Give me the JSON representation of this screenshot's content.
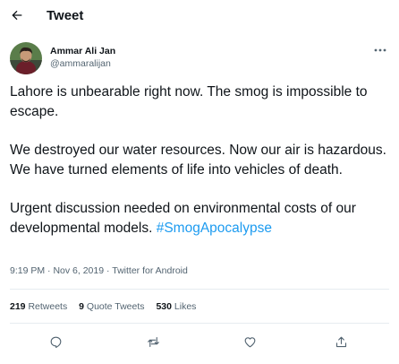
{
  "header": {
    "title": "Tweet",
    "back_icon": "arrow-left-icon"
  },
  "author": {
    "name": "Ammar Ali Jan",
    "handle": "@ammaralijan",
    "more_icon": "more-horizontal-icon"
  },
  "tweet": {
    "paragraph_1": "Lahore is unbearable right now. The smog is impossible to escape.",
    "paragraph_2": "We destroyed our water resources. Now our air is hazardous. We have turned elements of life into vehicles of death.",
    "paragraph_3_text": "Urgent discussion needed on environmental costs of our developmental models. ",
    "hashtag": "#SmogApocalypse"
  },
  "meta": {
    "time": "9:19 PM",
    "separator_1": " · ",
    "date": "Nov 6, 2019",
    "separator_2": " · ",
    "source": "Twitter for Android"
  },
  "stats": {
    "retweets_count": "219",
    "retweets_label": "Retweets",
    "quotes_count": "9",
    "quotes_label": "Quote Tweets",
    "likes_count": "530",
    "likes_label": "Likes"
  },
  "actions": {
    "reply_icon": "reply-icon",
    "retweet_icon": "retweet-icon",
    "like_icon": "heart-icon",
    "share_icon": "share-icon"
  },
  "colors": {
    "text": "#0f1419",
    "secondary": "#536471",
    "accent": "#1d9bf0",
    "divider": "#e6ecf0"
  }
}
